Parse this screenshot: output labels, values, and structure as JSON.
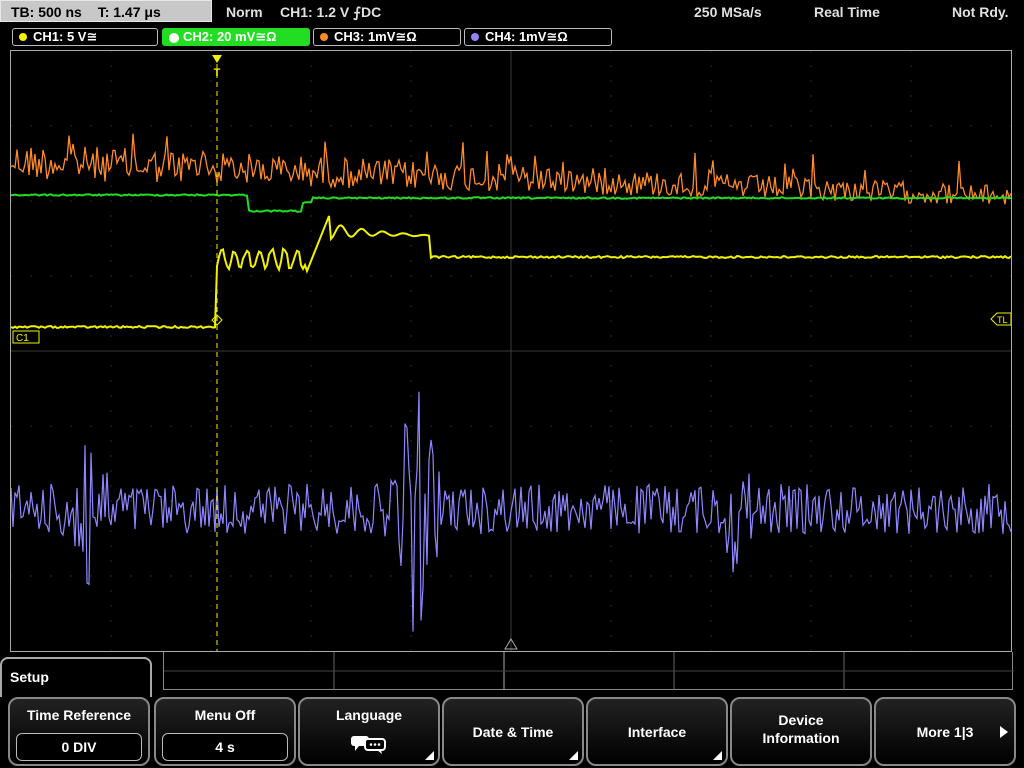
{
  "header": {
    "timebase": "TB: 500 ns",
    "trigger_time": "T: 1.47 μs",
    "mode": "Norm",
    "trigger": "CH1: 1.2 V ⨍DC",
    "sample_rate": "250 MSa/s",
    "acq_mode": "Real Time",
    "status": "Not Rdy."
  },
  "channels": [
    {
      "label": "CH1: 5 V≅",
      "color": "#f2f200"
    },
    {
      "label": "CH2: 20 mV≅Ω",
      "color": "#22dd22"
    },
    {
      "label": "CH3: 1mV≅Ω",
      "color": "#ff8a2a"
    },
    {
      "label": "CH4: 1mV≅Ω",
      "color": "#8f86ff"
    }
  ],
  "markers": {
    "ch1": "C1",
    "trigger_level": "TL",
    "trigger_pos": "T"
  },
  "menu": {
    "title": "Setup",
    "keys": [
      {
        "label": "Time Reference",
        "value": "0 DIV"
      },
      {
        "label": "Menu Off",
        "value": "4 s"
      },
      {
        "label": "Language",
        "icon": "speech-bubbles-icon"
      },
      {
        "label": "Date & Time"
      },
      {
        "label": "Interface"
      },
      {
        "label": "Device Information"
      },
      {
        "label": "More 1|3"
      }
    ]
  }
}
